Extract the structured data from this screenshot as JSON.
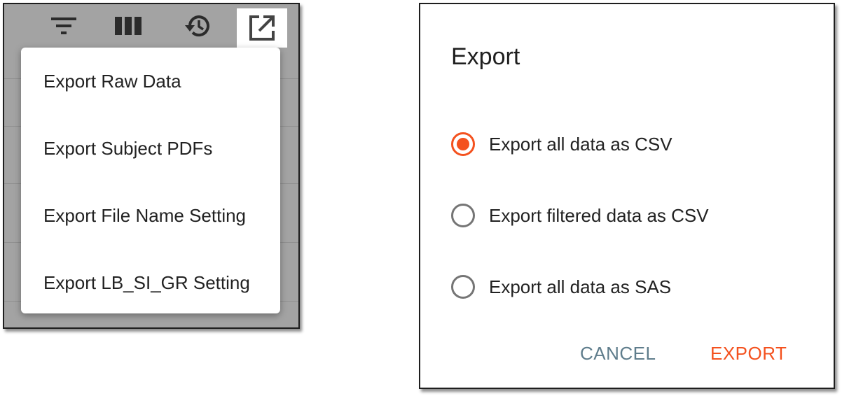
{
  "colors": {
    "accent": "#f4511e",
    "cancel": "#5f7d8c",
    "toolbar_bg": "#a3a3a3"
  },
  "toolbar": {
    "icons": [
      "filter-icon",
      "columns-icon",
      "history-icon",
      "export-icon"
    ]
  },
  "menu": {
    "items": [
      {
        "label": "Export Raw Data"
      },
      {
        "label": "Export Subject PDFs"
      },
      {
        "label": "Export File Name Setting"
      },
      {
        "label": "Export LB_SI_GR Setting"
      }
    ]
  },
  "dialog": {
    "title": "Export",
    "options": [
      {
        "label": "Export all data as CSV",
        "selected": true
      },
      {
        "label": "Export filtered data as CSV",
        "selected": false
      },
      {
        "label": "Export all data as SAS",
        "selected": false
      }
    ],
    "cancel_label": "CANCEL",
    "export_label": "EXPORT"
  }
}
